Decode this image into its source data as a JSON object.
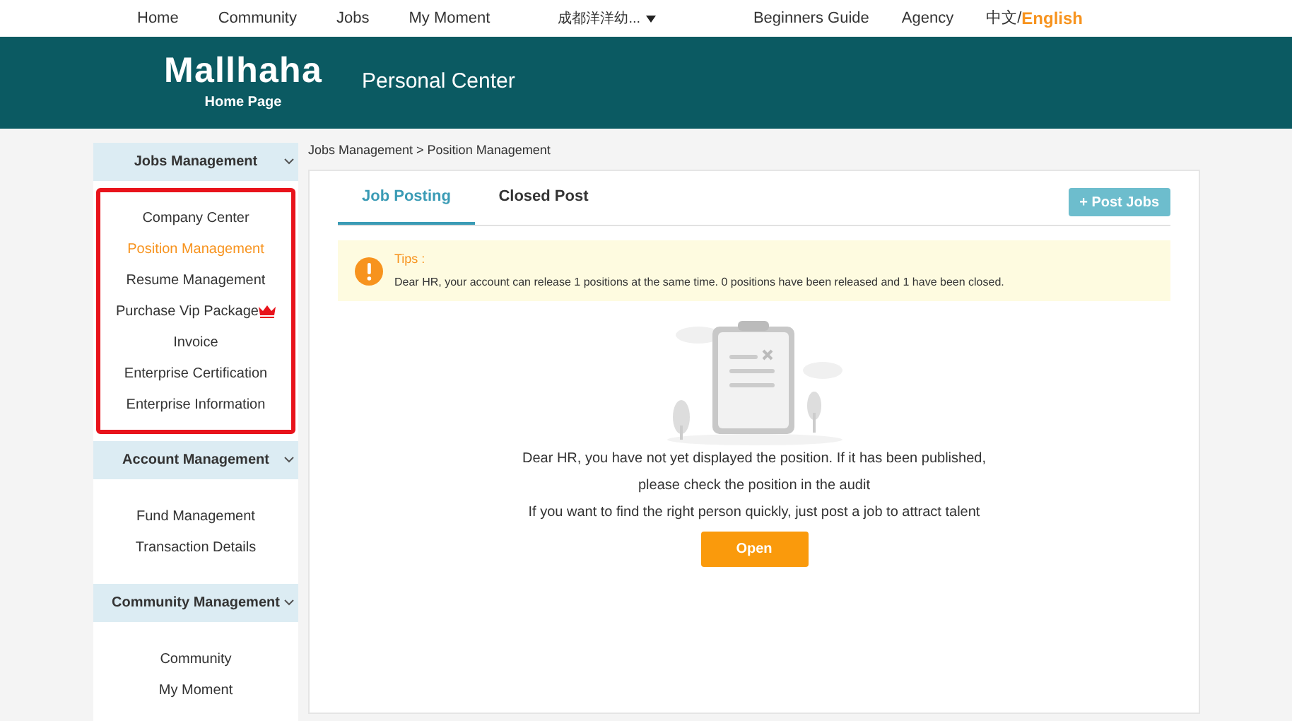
{
  "top_nav": {
    "links": [
      "Home",
      "Community",
      "Jobs",
      "My Moment"
    ],
    "city": "成都洋洋幼...",
    "right_links": [
      "Beginners Guide",
      "Agency"
    ],
    "languages": [
      {
        "label": "中文/",
        "selected": false
      },
      {
        "label": "English",
        "selected": true
      }
    ]
  },
  "header": {
    "logo": "Mallhaha",
    "logo_subtitle": "Home Page",
    "title": "Personal Center"
  },
  "sidebar": {
    "sections": [
      {
        "title": "Jobs Management",
        "highlighted": true,
        "items": [
          {
            "label": "Company Center",
            "selected": false
          },
          {
            "label": "Position Management",
            "selected": true
          },
          {
            "label": "Resume Management",
            "selected": false
          },
          {
            "label": "Purchase Vip Package",
            "selected": false,
            "vip": true
          },
          {
            "label": "Invoice",
            "selected": false
          },
          {
            "label": "Enterprise Certification",
            "selected": false
          },
          {
            "label": "Enterprise Information",
            "selected": false
          }
        ]
      },
      {
        "title": "Account Management",
        "highlighted": false,
        "items": [
          {
            "label": "Fund Management",
            "selected": false
          },
          {
            "label": "Transaction Details",
            "selected": false
          }
        ]
      },
      {
        "title": "Community Management",
        "highlighted": false,
        "items": [
          {
            "label": "Community",
            "selected": false
          },
          {
            "label": "My Moment",
            "selected": false
          }
        ]
      }
    ]
  },
  "breadcrumb": "Jobs Management > Position Management",
  "tabs": [
    {
      "label": "Job Posting",
      "selected": true
    },
    {
      "label": "Closed Post",
      "selected": false
    }
  ],
  "post_button": "+ Post Jobs",
  "tips": {
    "title": "Tips :",
    "text": "Dear HR, your account can release 1 positions at the same time. 0 positions have been released and 1 have been closed."
  },
  "empty_state": {
    "lines": [
      "Dear HR, you have not yet displayed the position. If it has been published,",
      "please check the position in the audit",
      "If you want to find the right person quickly, just post a job to attract talent"
    ],
    "button": "Open"
  }
}
